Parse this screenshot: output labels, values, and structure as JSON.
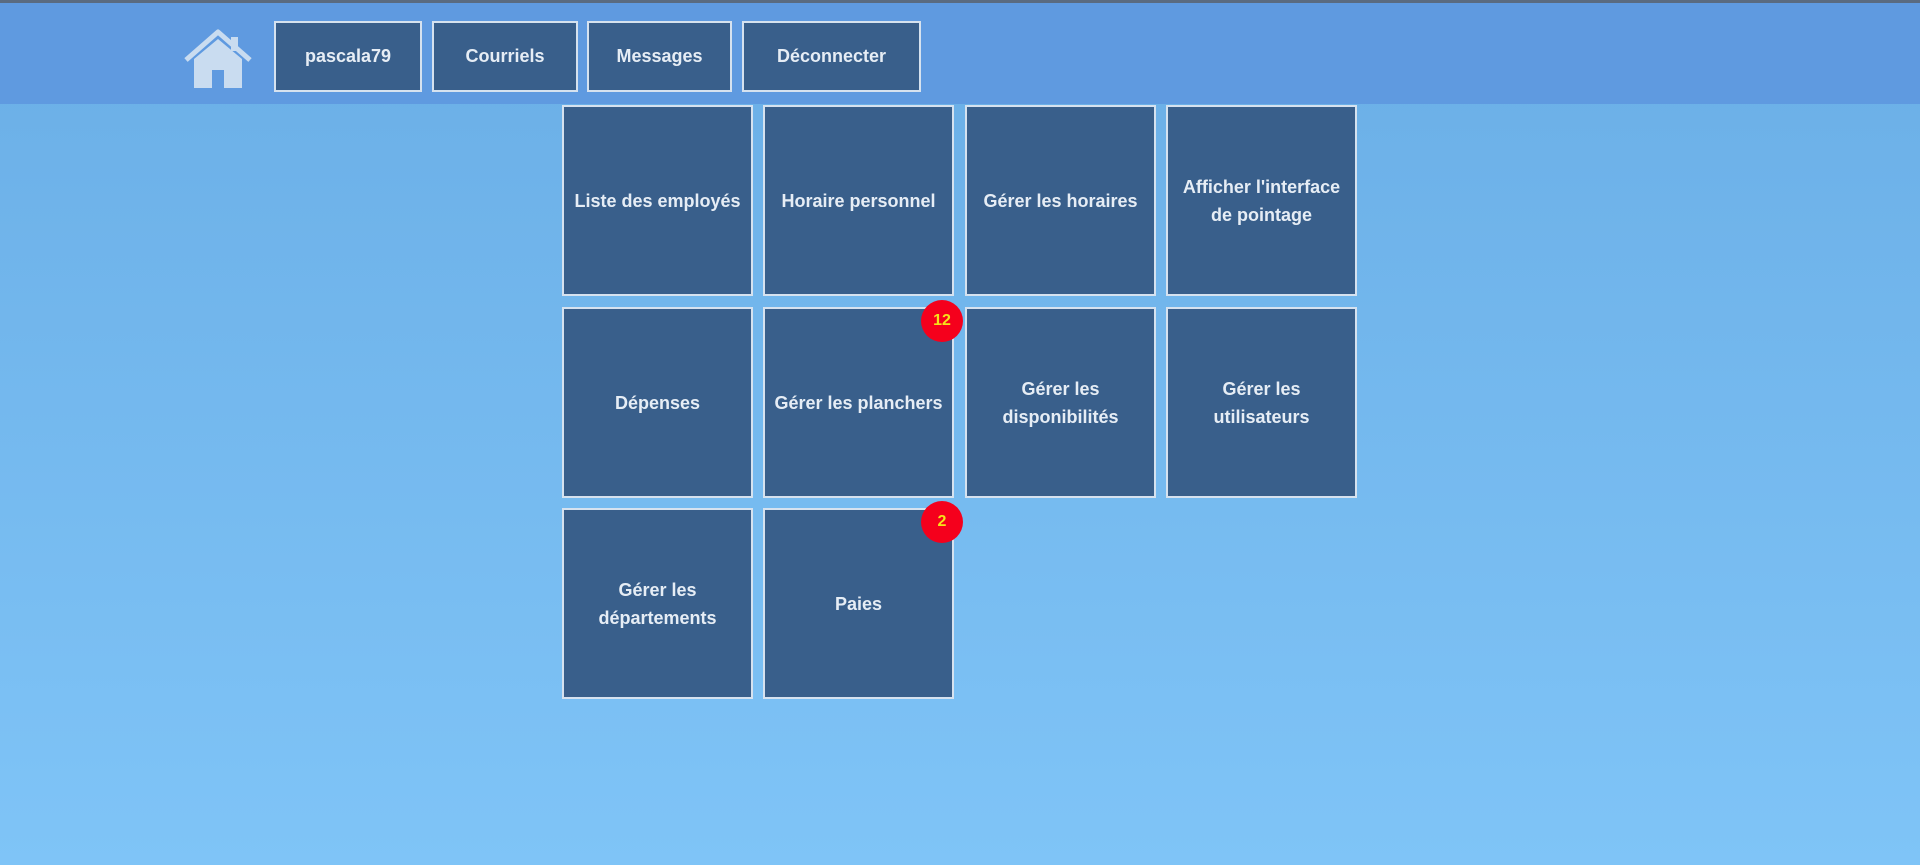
{
  "header": {
    "home_icon": "home-icon",
    "nav": [
      "pascala79",
      "Courriels",
      "Messages",
      "Déconnecter"
    ]
  },
  "tiles": [
    {
      "label": "Liste des employés"
    },
    {
      "label": "Horaire personnel"
    },
    {
      "label": "Gérer les horaires"
    },
    {
      "label": "Afficher l'interface de pointage"
    },
    {
      "label": "Dépenses"
    },
    {
      "label": "Gérer les planchers",
      "badge": "12"
    },
    {
      "label": "Gérer les disponibilités"
    },
    {
      "label": "Gérer les utilisateurs"
    },
    {
      "label": "Gérer les départements"
    },
    {
      "label": "Paies",
      "badge": "2"
    }
  ],
  "colors": {
    "tile_bg": "#395f8b",
    "header_bg": "#5f9ae0",
    "badge_bg": "#f5001c",
    "badge_text": "#f5e21a"
  }
}
